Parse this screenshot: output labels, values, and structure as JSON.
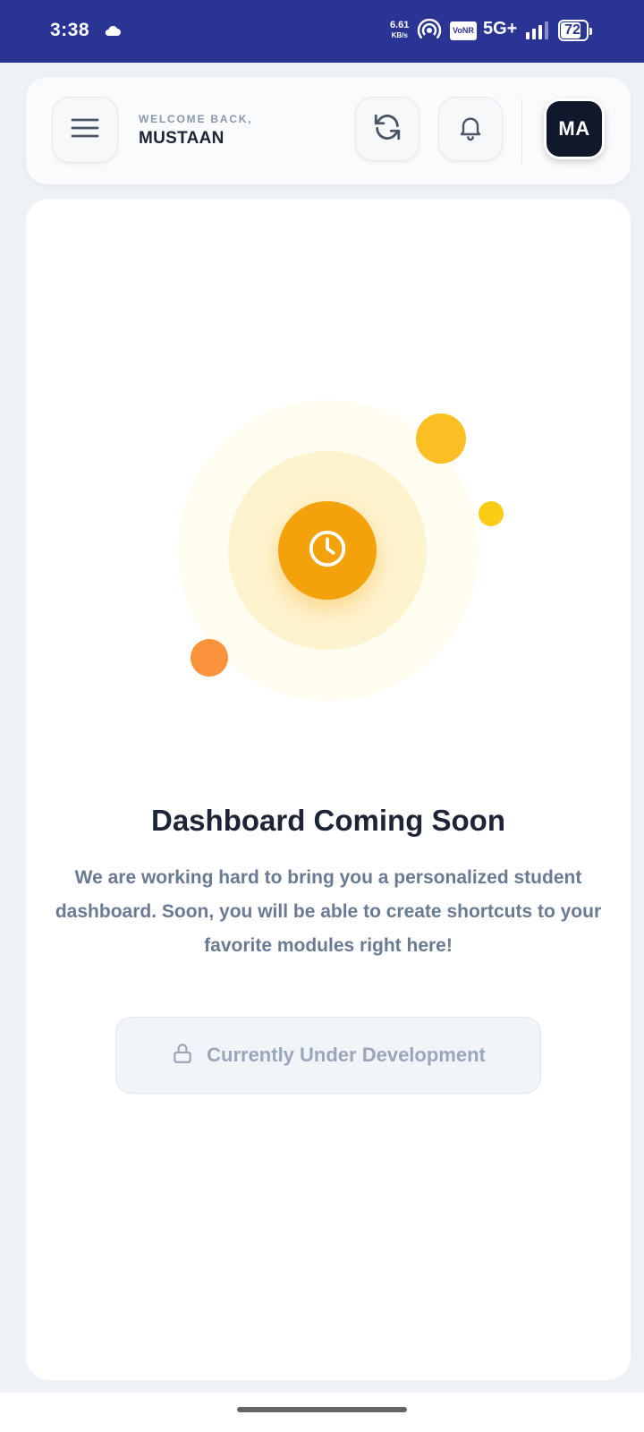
{
  "status_bar": {
    "time": "3:38",
    "net_speed": "6.61",
    "net_speed_unit": "KB/s",
    "vonr": "VoNR",
    "network": "5G+",
    "battery": "72"
  },
  "header": {
    "welcome_label": "WELCOME BACK,",
    "user_name": "MUSTAAN",
    "avatar_initials": "MA"
  },
  "main": {
    "title": "Dashboard Coming Soon",
    "description": "We are working hard to bring you a personalized student dashboard. Soon, you will be able to create shortcuts to your favorite modules right here!",
    "status_button": "Currently Under Development"
  },
  "colors": {
    "status_bar_bg": "#2a3494",
    "accent": "#f4a20c",
    "title": "#1c2436",
    "muted": "#6b7a93"
  },
  "icons": {
    "menu": "menu-icon",
    "refresh": "refresh-icon",
    "notifications": "bell-icon",
    "clock": "clock-icon",
    "lock": "lock-icon"
  }
}
